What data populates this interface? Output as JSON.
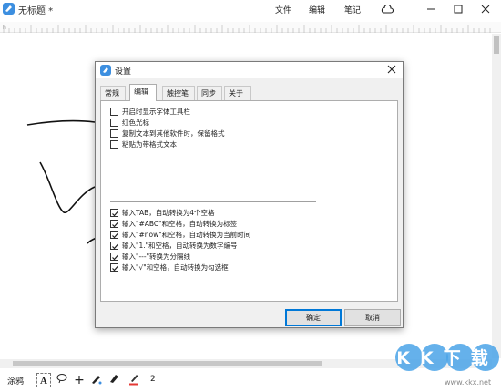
{
  "window": {
    "title": "无标题 *"
  },
  "menu": {
    "items": [
      "文件",
      "编辑",
      "笔记"
    ]
  },
  "icons": {
    "app": "app-logo-icon",
    "cloud": "cloud-icon",
    "minimize": "minimize-icon",
    "maximize": "maximize-icon",
    "close": "close-icon"
  },
  "toolbar": {
    "label": "涂鸦",
    "tools": [
      "text-tool-icon",
      "lasso-icon",
      "plus-icon",
      "pen-tool-icon",
      "highlighter-icon",
      "color-pen-icon"
    ],
    "active_tool": "text-tool-icon",
    "stroke_size": "2",
    "pen_color": "#e53935"
  },
  "dialog": {
    "title": "设置",
    "tabs": [
      "常规",
      "编辑",
      "触控笔",
      "同步",
      "关于"
    ],
    "active_tab": "编辑",
    "options_group1": [
      {
        "label": "开启时显示字体工具栏",
        "checked": false
      },
      {
        "label": "红色光标",
        "checked": false
      },
      {
        "label": "复制文本到其他软件时，保留格式",
        "checked": false
      },
      {
        "label": "粘贴为带格式文本",
        "checked": false
      }
    ],
    "options_group2": [
      {
        "label": "输入TAB，自动转换为4个空格",
        "checked": true
      },
      {
        "label": "输入\"#ABC\"和空格，自动转换为标签",
        "checked": true
      },
      {
        "label": "输入\"#now\"和空格，自动转换为当前时间",
        "checked": true
      },
      {
        "label": "输入\"1.\"和空格，自动转换为数字编号",
        "checked": true
      },
      {
        "label": "输入\"---\"转换为分隔线",
        "checked": true
      },
      {
        "label": "输入\"√\"和空格，自动转换为勾选框",
        "checked": true
      }
    ],
    "ok_label": "确定",
    "cancel_label": "取消"
  },
  "watermark": {
    "logo": "KK下载",
    "url": "www.kkx.net"
  },
  "colors": {
    "accent": "#0078d7",
    "app_blue": "#3d8fe0",
    "watermark_blue": "#4aa3e8"
  }
}
